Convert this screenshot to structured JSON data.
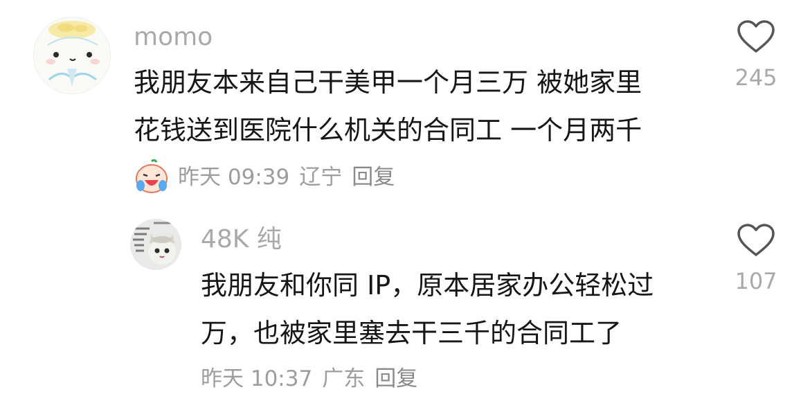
{
  "comments": [
    {
      "user": "momo",
      "text": "我朋友本来自己干美甲一个月三万 被她家里\n花钱送到医院什么机关的合同工 一个月两千",
      "time": "昨天 09:39",
      "location": "辽宁",
      "reply_label": "回复",
      "likes": "245",
      "emoji": "crying-laughing-face-icon"
    },
    {
      "user": "48K 纯",
      "text": "我朋友和你同 IP，原本居家办公轻松过\n万，也被家里塞去干三千的合同工了",
      "time": "昨天 10:37",
      "location": "广东",
      "reply_label": "回复",
      "likes": "107"
    }
  ],
  "colors": {
    "username": "#a9a9a9",
    "text": "#161616",
    "meta": "#9d9d9d",
    "heart_stroke": "#555555"
  }
}
